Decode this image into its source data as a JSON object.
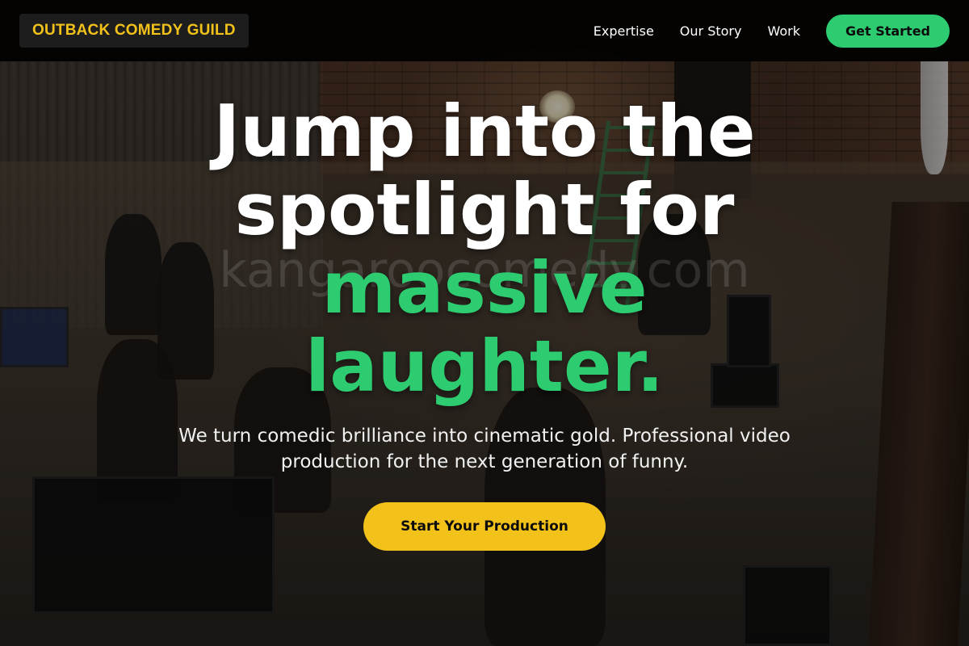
{
  "nav": {
    "logo_text": "OUTBACK COMEDY GUILD",
    "links": [
      "Expertise",
      "Our Story",
      "Work"
    ],
    "cta_label": "Get Started"
  },
  "hero": {
    "headline_line1": "Jump into the",
    "headline_line2": "spotlight for",
    "headline_accent_line1": "massive",
    "headline_accent_line2": "laughter.",
    "watermark": "kangaroocomedy.com",
    "subtitle": "We turn comedic brilliance into cinematic gold. Professional video production for the next generation of funny.",
    "cta_label": "Start Your Production"
  },
  "colors": {
    "accent_green": "#2ecc71",
    "accent_yellow": "#f2c21b",
    "nav_bg": "#000000"
  }
}
